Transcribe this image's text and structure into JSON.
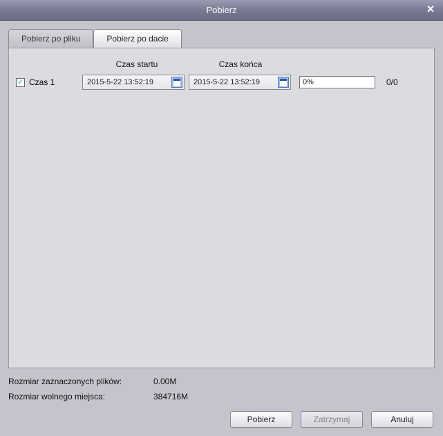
{
  "title": "Pobierz",
  "tabs": {
    "by_file": "Pobierz po pliku",
    "by_date": "Pobierz po dacie"
  },
  "headers": {
    "start_time": "Czas startu",
    "end_time": "Czas końca"
  },
  "row": {
    "label": "Czas 1",
    "checked": true,
    "start_value": "2015-5-22 13:52:19",
    "end_value": "2015-5-22 13:52:19",
    "progress_text": "0%",
    "fraction": "0/0"
  },
  "footer": {
    "selected_label": "Rozmiar zaznaczonych plików:",
    "selected_value": "0.00M",
    "free_label": "Rozmiar wolnego miejsca:",
    "free_value": "384716M"
  },
  "buttons": {
    "download": "Pobierz",
    "stop": "Zatrzymaj",
    "cancel": "Anuluj"
  }
}
